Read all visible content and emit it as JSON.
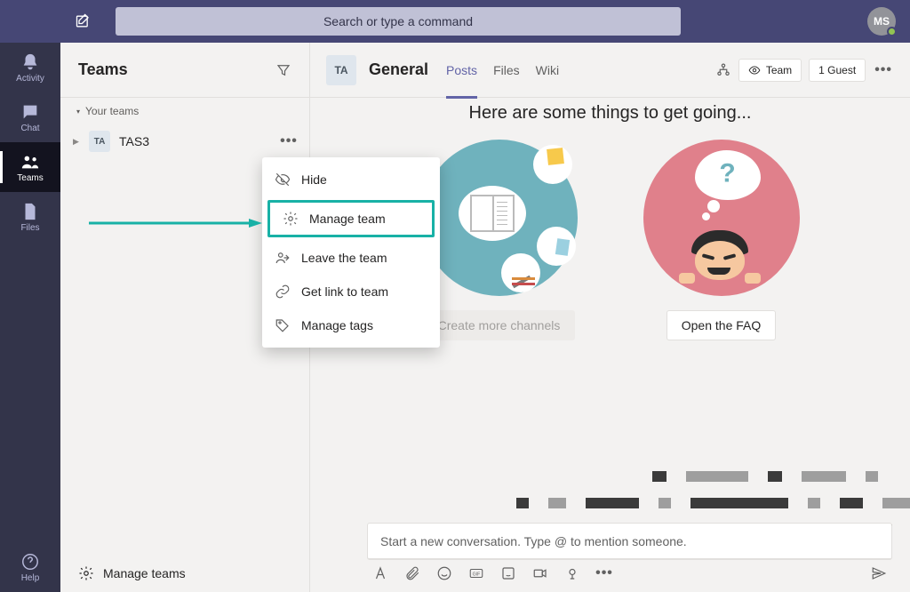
{
  "titlebar": {
    "search_placeholder": "Search or type a command",
    "avatar_initials": "MS"
  },
  "rail": {
    "activity": "Activity",
    "chat": "Chat",
    "teams": "Teams",
    "files": "Files",
    "help": "Help"
  },
  "sidebar": {
    "title": "Teams",
    "section_label": "Your teams",
    "team": {
      "avatar": "TA",
      "name": "TAS3"
    },
    "footer": "Manage teams"
  },
  "context_menu": {
    "hide": "Hide",
    "manage_team": "Manage team",
    "leave": "Leave the team",
    "get_link": "Get link to team",
    "manage_tags": "Manage tags"
  },
  "channel": {
    "avatar": "TA",
    "name": "General",
    "tabs": {
      "posts": "Posts",
      "files": "Files",
      "wiki": "Wiki"
    },
    "privacy_label": "Team",
    "guest_label": "1 Guest"
  },
  "welcome": {
    "heading": "Here are some things to get going...",
    "create_channels": "Create more channels",
    "open_faq": "Open the FAQ"
  },
  "composer": {
    "placeholder": "Start a new conversation. Type @ to mention someone."
  }
}
